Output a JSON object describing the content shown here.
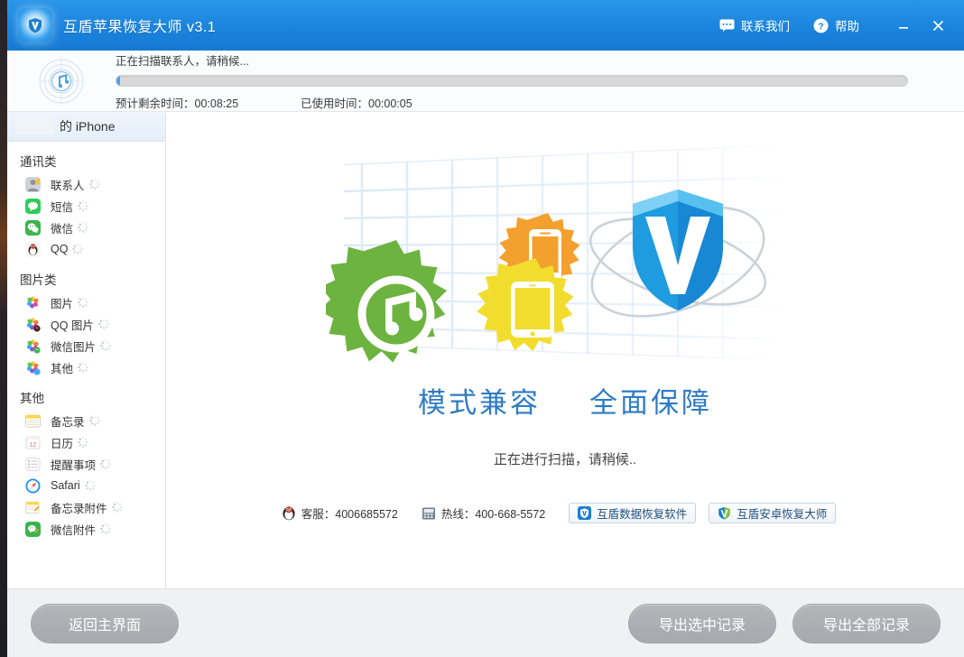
{
  "window": {
    "title": "互盾苹果恢复大师 v3.1",
    "logo_icon": "shield-logo-icon",
    "accent_color": "#1b84dd",
    "actions": [
      {
        "label": "联系我们",
        "icon": "chat-bubble-icon"
      },
      {
        "label": "帮助",
        "icon": "question-circle-icon"
      }
    ],
    "controls": {
      "minimize": "_",
      "close": "✕"
    }
  },
  "scan_panel": {
    "icon": "radar-music-scan-icon",
    "status_text": "正在扫描联系人，请稍候...",
    "progress_percent": 0,
    "time_remaining_label": "预计剩余时间：",
    "time_remaining_value": "00:08:25",
    "time_elapsed_label": "已使用时间：",
    "time_elapsed_value": "00:00:05"
  },
  "sidebar": {
    "device_tab": {
      "redacted": true,
      "label": "的 iPhone"
    },
    "groups": [
      {
        "title": "通讯类",
        "items": [
          {
            "label": "联系人",
            "icon": "contacts-icon",
            "color": "#8d9199",
            "scanning": true
          },
          {
            "label": "短信",
            "icon": "messages-icon",
            "color": "#2ecc5a",
            "scanning": true
          },
          {
            "label": "微信",
            "icon": "wechat-icon",
            "color": "#39b54a",
            "scanning": true
          },
          {
            "label": "QQ",
            "icon": "qq-penguin-icon",
            "color": "#f7f7f7",
            "scanning": true
          }
        ]
      },
      {
        "title": "图片类",
        "items": [
          {
            "label": "图片",
            "icon": "photos-icon",
            "color": "#ffffff",
            "scanning": true
          },
          {
            "label": "QQ 图片",
            "icon": "qq-photos-icon",
            "color": "#ffffff",
            "scanning": true
          },
          {
            "label": "微信图片",
            "icon": "wechat-photos-icon",
            "color": "#ffffff",
            "scanning": true
          },
          {
            "label": "其他",
            "icon": "other-photos-icon",
            "color": "#ffffff",
            "scanning": true
          }
        ]
      },
      {
        "title": "其他",
        "items": [
          {
            "label": "备忘录",
            "icon": "notes-icon",
            "color": "#ffd84d",
            "scanning": true
          },
          {
            "label": "日历",
            "icon": "calendar-icon",
            "color": "#ffffff",
            "scanning": true
          },
          {
            "label": "提醒事项",
            "icon": "reminders-icon",
            "color": "#ffffff",
            "scanning": true
          },
          {
            "label": "Safari",
            "icon": "safari-icon",
            "color": "#1f8ef1",
            "scanning": true
          },
          {
            "label": "备忘录附件",
            "icon": "notes-attachment-icon",
            "color": "#ffd84d",
            "scanning": true
          },
          {
            "label": "微信附件",
            "icon": "wechat-attachment-icon",
            "color": "#39b54a",
            "scanning": true
          }
        ]
      }
    ]
  },
  "main": {
    "illustration": "gears-phone-shield-illustration",
    "slogans": [
      "模式兼容",
      "全面保障"
    ],
    "scan_hint": "正在进行扫描，请稍候..",
    "contacts": [
      {
        "icon": "qq-penguin-icon",
        "label": "客服：4006685572"
      },
      {
        "icon": "telephone-icon",
        "label": "热线：400-668-5572"
      }
    ],
    "promo_buttons": [
      {
        "icon": "hudun-data-recovery-icon",
        "label": "互盾数据恢复软件"
      },
      {
        "icon": "hudun-android-recovery-icon",
        "label": "互盾安卓恢复大师"
      }
    ]
  },
  "footer": {
    "back_label": "返回主界面",
    "export_selected_label": "导出选中记录",
    "export_all_label": "导出全部记录"
  }
}
